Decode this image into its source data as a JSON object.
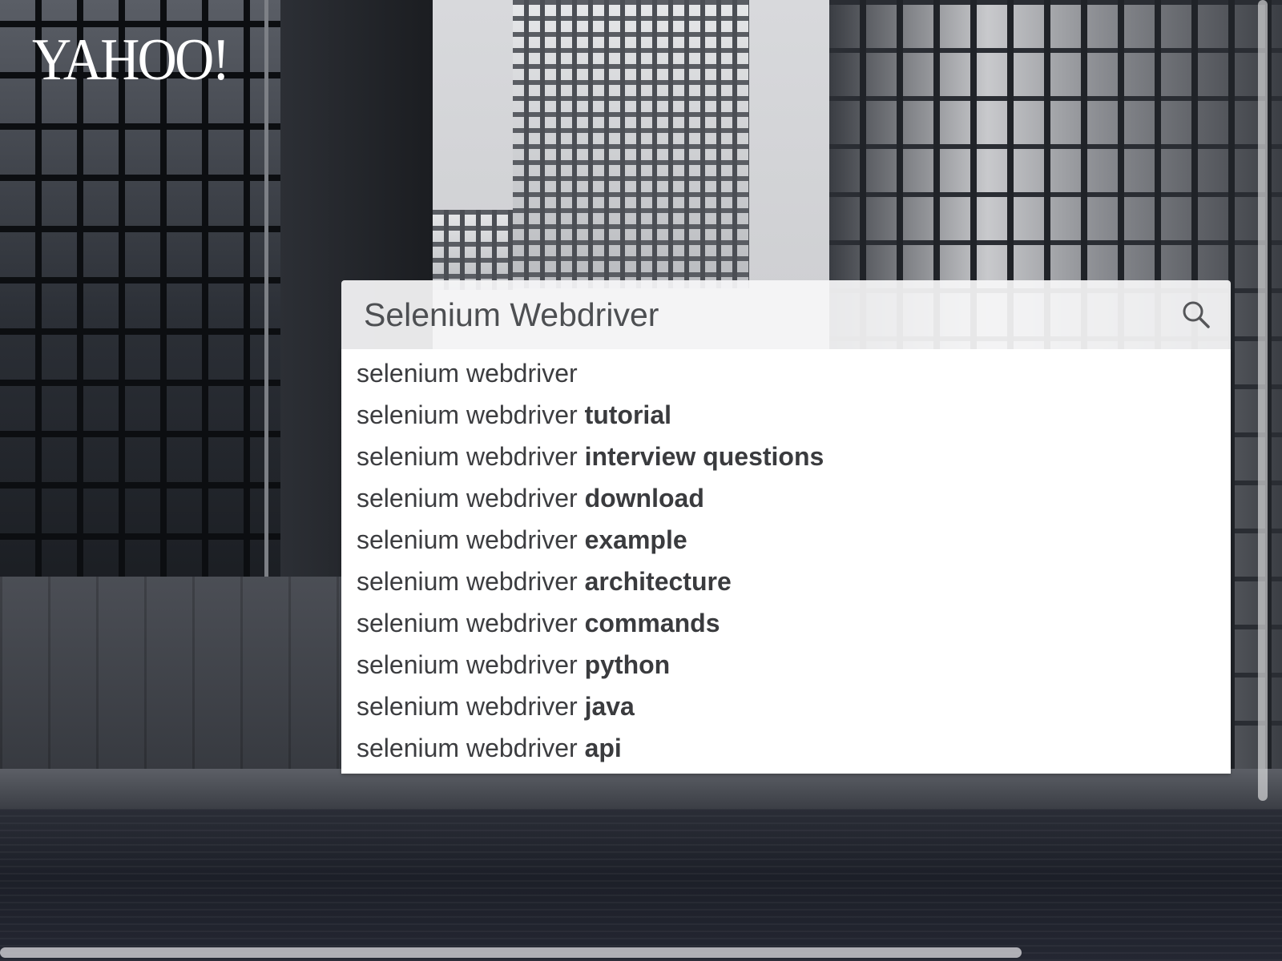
{
  "logo": {
    "text": "YAHOO!"
  },
  "search": {
    "value": "Selenium Webdriver",
    "icon": "search-icon"
  },
  "suggestions": [
    {
      "base": "selenium webdriver",
      "extra": ""
    },
    {
      "base": "selenium webdriver ",
      "extra": "tutorial"
    },
    {
      "base": "selenium webdriver ",
      "extra": "interview questions"
    },
    {
      "base": "selenium webdriver ",
      "extra": "download"
    },
    {
      "base": "selenium webdriver ",
      "extra": "example"
    },
    {
      "base": "selenium webdriver ",
      "extra": "architecture"
    },
    {
      "base": "selenium webdriver ",
      "extra": "commands"
    },
    {
      "base": "selenium webdriver ",
      "extra": "python"
    },
    {
      "base": "selenium webdriver ",
      "extra": "java"
    },
    {
      "base": "selenium webdriver ",
      "extra": "api"
    }
  ]
}
